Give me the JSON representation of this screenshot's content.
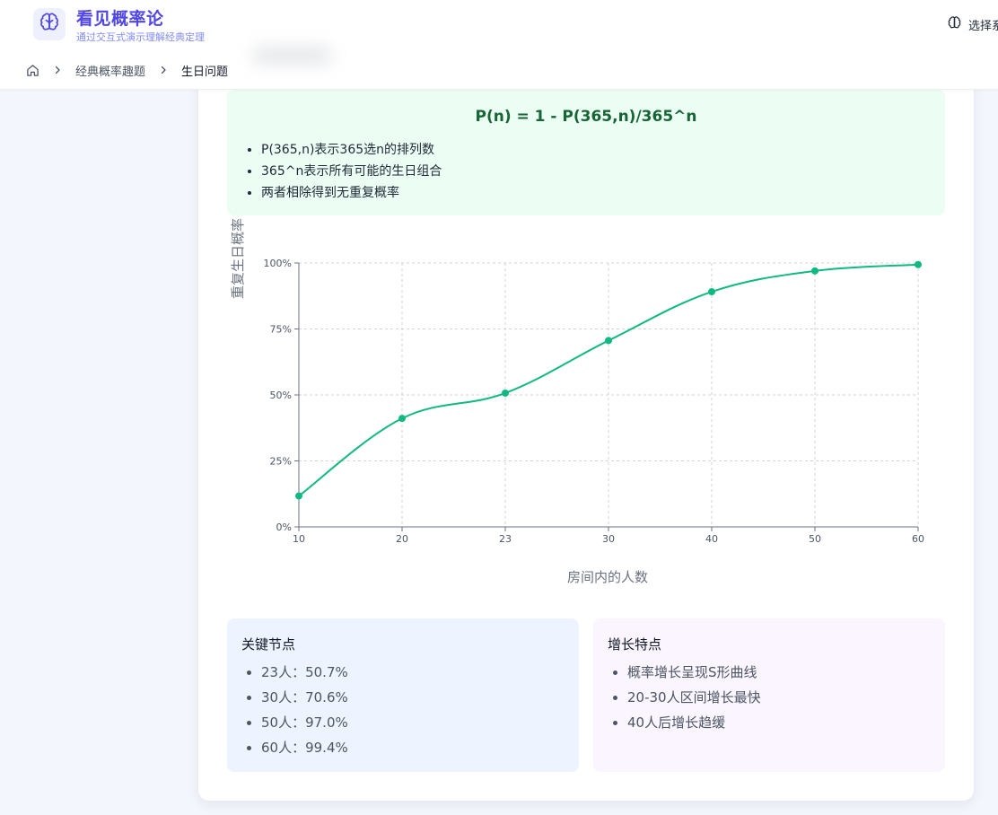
{
  "header": {
    "title": "看见概率论",
    "subtitle": "通过交互式演示理解经典定理",
    "language_button": "选择系"
  },
  "breadcrumb": {
    "items": [
      "经典概率趣题"
    ],
    "current": "生日问题"
  },
  "formula_section": {
    "formula": "P(n) = 1 - P(365,n)/365^n",
    "notes": [
      "P(365,n)表示365选n的排列数",
      "365^n表示所有可能的生日组合",
      "两者相除得到无重复概率"
    ]
  },
  "chart_data": {
    "type": "line",
    "x": [
      10,
      20,
      23,
      30,
      40,
      50,
      60
    ],
    "y": [
      11.7,
      41.1,
      50.7,
      70.6,
      89.1,
      97.0,
      99.4
    ],
    "xlabel": "房间内的人数",
    "ylabel": "重复生日概率",
    "y_ticks": [
      "0%",
      "25%",
      "50%",
      "75%",
      "100%"
    ],
    "x_ticks": [
      "10",
      "20",
      "23",
      "30",
      "40",
      "50",
      "60"
    ],
    "ylim": [
      0,
      100
    ],
    "grid": true,
    "line_color": "#10b981"
  },
  "key_points": {
    "title": "关键节点",
    "items": [
      "23人：50.7%",
      "30人：70.6%",
      "50人：97.0%",
      "60人：99.4%"
    ]
  },
  "growth": {
    "title": "增长特点",
    "items": [
      "概率增长呈现S形曲线",
      "20-30人区间增长最快",
      "40人后增长趋缓"
    ]
  }
}
